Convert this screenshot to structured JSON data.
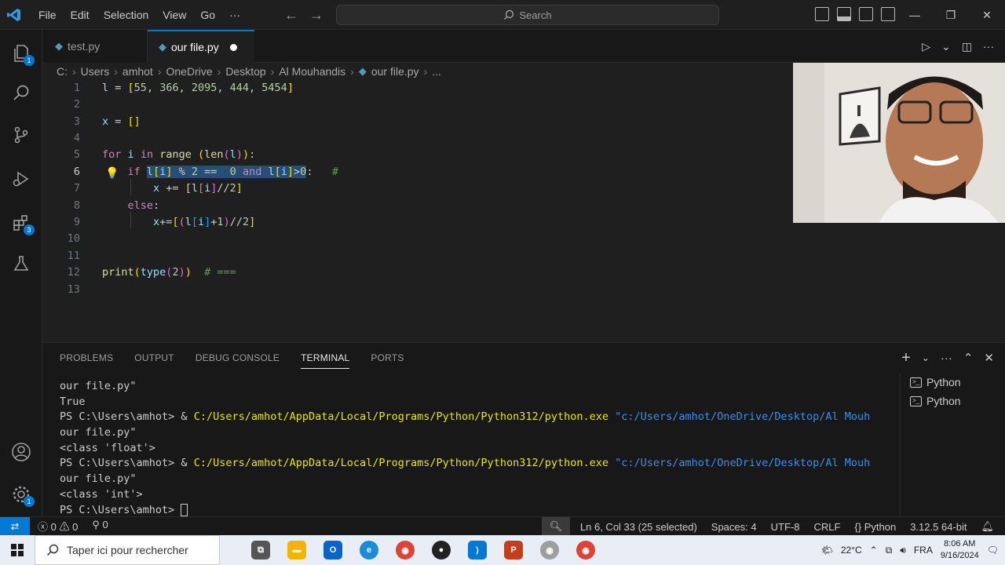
{
  "menu": [
    "File",
    "Edit",
    "Selection",
    "View",
    "Go",
    "···"
  ],
  "search_label": "Search",
  "tabs": [
    {
      "label": "test.py",
      "active": false
    },
    {
      "label": "our file.py",
      "active": true,
      "unsaved": true
    }
  ],
  "breadcrumb": [
    "C:",
    "Users",
    "amhot",
    "OneDrive",
    "Desktop",
    "Al Mouhandis",
    "our file.py",
    "..."
  ],
  "editor": {
    "line_numbers": [
      "1",
      "2",
      "3",
      "4",
      "5",
      "6",
      "7",
      "8",
      "9",
      "10",
      "11",
      "12",
      "13"
    ],
    "current_line": "6"
  },
  "panel": {
    "tabs": [
      "PROBLEMS",
      "OUTPUT",
      "DEBUG CONSOLE",
      "TERMINAL",
      "PORTS"
    ],
    "active_tab": "TERMINAL",
    "terminal": {
      "line1": "our file.py\"",
      "line2": "True",
      "ps_prompt": "PS C:\\Users\\amhot> & ",
      "python_exe": "C:/Users/amhot/AppData/Local/Programs/Python/Python312/python.exe",
      "script_arg": "\"c:/Users/amhot/OneDrive/Desktop/Al Mouh",
      "line4": "our file.py\"",
      "line5": "<class 'float'>",
      "line7": "our file.py\"",
      "line8": "<class 'int'>",
      "final_prompt": "PS C:\\Users\\amhot> "
    },
    "terminal_list": [
      "Python",
      "Python"
    ]
  },
  "activity_badges": {
    "explorer": "1",
    "extensions": "3",
    "settings": "1"
  },
  "statusbar": {
    "problems": "0",
    "warnings": "0",
    "ports": "0",
    "position": "Ln 6, Col 33 (25 selected)",
    "spaces": "Spaces: 4",
    "encoding": "UTF-8",
    "eol": "CRLF",
    "language": "Python",
    "interpreter": "3.12.5 64-bit"
  },
  "taskbar": {
    "search_placeholder": "Taper ici pour rechercher",
    "temperature": "22°C",
    "lang": "FRA",
    "time": "8:06 AM",
    "date": "9/16/2024"
  },
  "colors": {
    "accent": "#0078d4",
    "selection": "#264f78",
    "bg": "#1f1f1f"
  }
}
